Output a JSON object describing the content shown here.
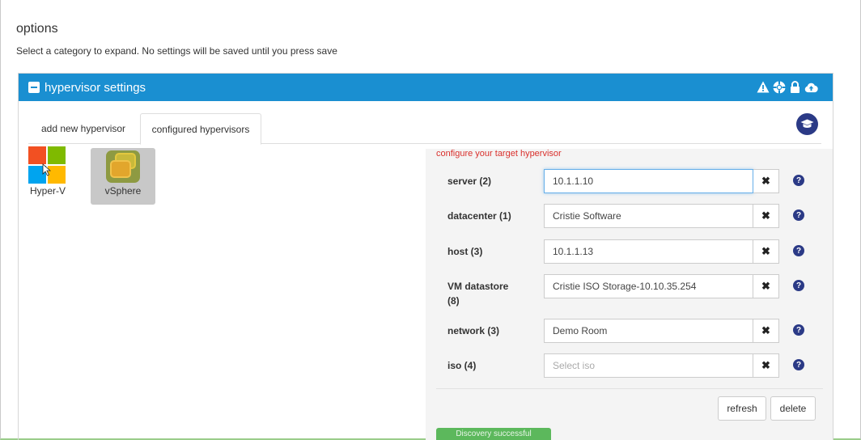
{
  "page": {
    "title": "options",
    "subtitle": "Select a category to expand. No settings will be saved until you press save"
  },
  "panel": {
    "title": "hypervisor settings",
    "header_color": "#1a8fd1",
    "header_icons": [
      "warning-icon",
      "lifebuoy-icon",
      "lock-icon",
      "cloud-upload-icon"
    ]
  },
  "tabs": [
    {
      "label": "add new hypervisor",
      "active": false
    },
    {
      "label": "configured hypervisors",
      "active": true
    }
  ],
  "hypervisors": [
    {
      "label": "Hyper-V",
      "icon": "windows-logo-icon",
      "selected": false
    },
    {
      "label": "vSphere",
      "icon": "vsphere-logo-icon",
      "selected": true
    }
  ],
  "form": {
    "heading": "configure your target hypervisor",
    "fields": [
      {
        "label": "server (2)",
        "value": "10.1.1.10",
        "placeholder": ""
      },
      {
        "label": "datacenter (1)",
        "value": "Cristie Software",
        "placeholder": ""
      },
      {
        "label": "host (3)",
        "value": "10.1.1.13",
        "placeholder": ""
      },
      {
        "label": "VM datastore (8)",
        "value": "Cristie ISO Storage-10.10.35.254",
        "placeholder": ""
      },
      {
        "label": "network (3)",
        "value": "Demo Room",
        "placeholder": ""
      },
      {
        "label": "iso (4)",
        "value": "",
        "placeholder": "Select iso"
      }
    ],
    "clear_glyph": "✖",
    "help_glyph": "?",
    "refresh_label": "refresh",
    "delete_label": "delete"
  },
  "status": {
    "text": "Discovery successful",
    "color": "#5cb85c"
  }
}
